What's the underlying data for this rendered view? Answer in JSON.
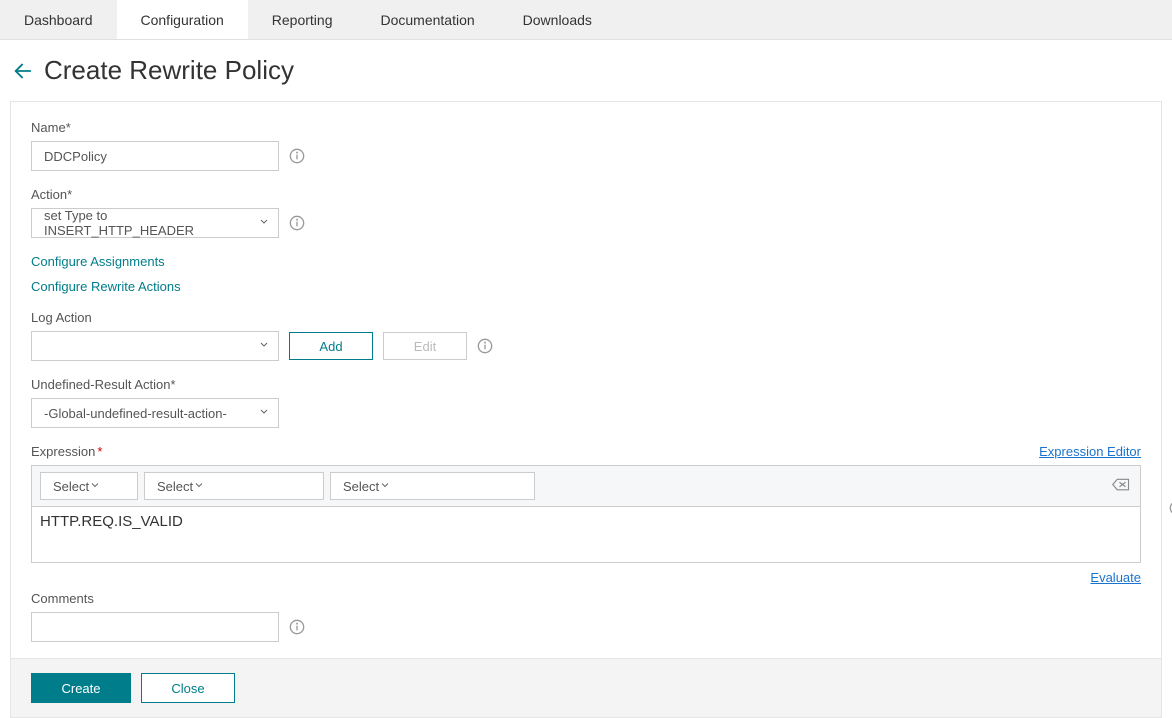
{
  "tabs": {
    "dashboard": "Dashboard",
    "configuration": "Configuration",
    "reporting": "Reporting",
    "documentation": "Documentation",
    "downloads": "Downloads"
  },
  "page": {
    "title": "Create Rewrite Policy"
  },
  "form": {
    "name_label": "Name",
    "name_value": "DDCPolicy",
    "action_label": "Action",
    "action_value": "set Type to INSERT_HTTP_HEADER",
    "configure_assignments": "Configure Assignments",
    "configure_rewrite_actions": "Configure Rewrite Actions",
    "log_action_label": "Log Action",
    "log_action_value": "",
    "add_label": "Add",
    "edit_label": "Edit",
    "undef_label": "Undefined-Result Action",
    "undef_value": "-Global-undefined-result-action-",
    "expression_label": "Expression",
    "expression_editor_link": "Expression Editor",
    "tb_select1": "Select",
    "tb_select2": "Select",
    "tb_select3": "Select",
    "expression_value": "HTTP.REQ.IS_VALID",
    "evaluate_link": "Evaluate",
    "comments_label": "Comments",
    "comments_value": ""
  },
  "footer": {
    "create": "Create",
    "close": "Close"
  }
}
